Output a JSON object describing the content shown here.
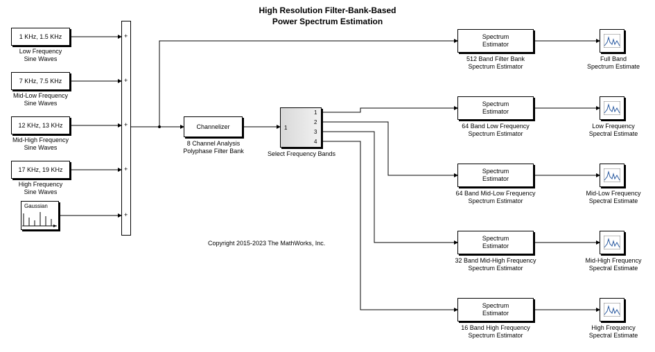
{
  "title_line1": "High Resolution Filter-Bank-Based",
  "title_line2": "Power Spectrum Estimation",
  "copyright": "Copyright 2015-2023 The MathWorks, Inc.",
  "sources": [
    {
      "label": "Low Frequency\nSine Waves",
      "text": "1 KHz, 1.5 KHz"
    },
    {
      "label": "Mid-Low Frequency\nSine Waves",
      "text": "7 KHz, 7.5 KHz"
    },
    {
      "label": "Mid-High Frequency\nSine Waves",
      "text": "12 KHz, 13 KHz"
    },
    {
      "label": "High Frequency\nSine Waves",
      "text": "17 KHz, 19 KHz"
    }
  ],
  "gaussian": {
    "text": "Gaussian"
  },
  "channelizer": {
    "text": "Channelizer",
    "label": "8 Channel Analysis\nPolyphase Filter Bank"
  },
  "selector": {
    "label": "Select Frequency Bands",
    "in_port": "1",
    "out_ports": [
      "1",
      "2",
      "3",
      "4"
    ]
  },
  "est_label": "Spectrum\nEstimator",
  "estimators": [
    {
      "label": "512 Band Filter Bank\nSpectrum Estimator",
      "scope": "Full Band\nSpectrum Estimate"
    },
    {
      "label": "64 Band Low Frequency\nSpectrum Estimator",
      "scope": "Low Frequency\nSpectral Estimate"
    },
    {
      "label": "64 Band Mid-Low Frequency\nSpectrum Estimator",
      "scope": "Mid-Low Frequency\nSpectral Estimate"
    },
    {
      "label": "32 Band Mid-High Frequency\nSpectrum Estimator",
      "scope": "Mid-High Frequency\nSpectral Estimate"
    },
    {
      "label": "16 Band High Frequency\nSpectrum Estimator",
      "scope": "High Frequency\nSpectral Estimate"
    }
  ]
}
